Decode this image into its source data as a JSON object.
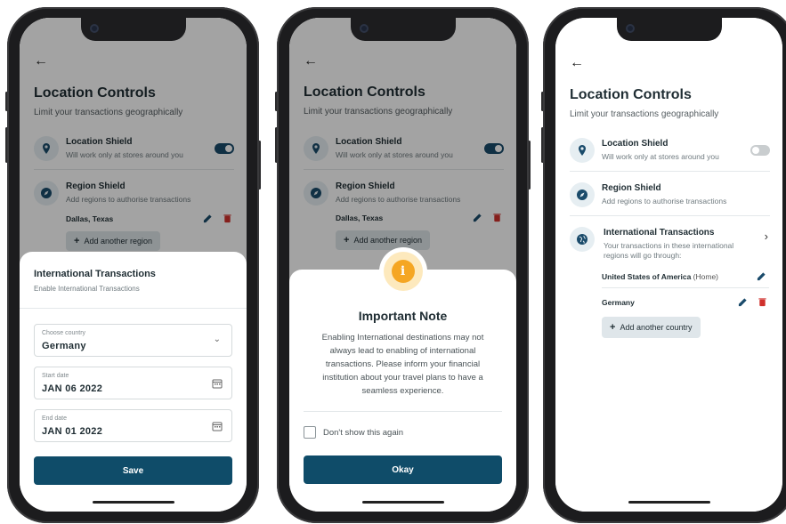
{
  "screens": [
    {
      "back_icon": "back-arrow-icon",
      "title": "Location Controls",
      "subtitle": "Limit your transactions geographically",
      "location_shield": {
        "title": "Location Shield",
        "subtitle": "Will work only at stores around you",
        "toggle_on": true
      },
      "region_shield": {
        "title": "Region Shield",
        "subtitle": "Add regions to authorise transactions",
        "region": "Dallas, Texas",
        "add_label": "Add another region"
      },
      "sheet": {
        "title": "International Transactions",
        "subtitle": "Enable International Transactions",
        "country_label": "Choose country",
        "country_value": "Germany",
        "start_label": "Start date",
        "start_value": "JAN 06  2022",
        "end_label": "End date",
        "end_value": "JAN 01  2022",
        "save_label": "Save"
      }
    },
    {
      "back_icon": "back-arrow-icon",
      "title": "Location Controls",
      "subtitle": "Limit your transactions geographically",
      "location_shield": {
        "title": "Location Shield",
        "subtitle": "Will work only at stores around you",
        "toggle_on": true
      },
      "region_shield": {
        "title": "Region Shield",
        "subtitle": "Add regions to authorise transactions",
        "region": "Dallas, Texas",
        "add_label": "Add another region"
      },
      "note": {
        "title": "Important Note",
        "body": "Enabling International destinations may not always lead to enabling of international transactions. Please inform your financial institution about your travel plans to have a seamless experience.",
        "checkbox_label": "Don't show this again",
        "okay_label": "Okay"
      }
    },
    {
      "back_icon": "back-arrow-icon",
      "title": "Location Controls",
      "subtitle": "Limit your transactions geographically",
      "location_shield": {
        "title": "Location Shield",
        "subtitle": "Will work only at stores around you",
        "toggle_on": false
      },
      "region_shield": {
        "title": "Region Shield",
        "subtitle": "Add regions to authorise transactions"
      },
      "international": {
        "title": "International Transactions",
        "subtitle": "Your transactions in these international regions will go through:",
        "country_1": "United States of America",
        "country_1_tag": "(Home)",
        "country_2": "Germany",
        "add_label": "Add another country"
      }
    }
  ],
  "colors": {
    "primary": "#0f4c69",
    "toggle_on": "#1a4b6b",
    "toggle_off": "#c9cdcf",
    "delete": "#d0312d",
    "warning": "#f5a623"
  }
}
